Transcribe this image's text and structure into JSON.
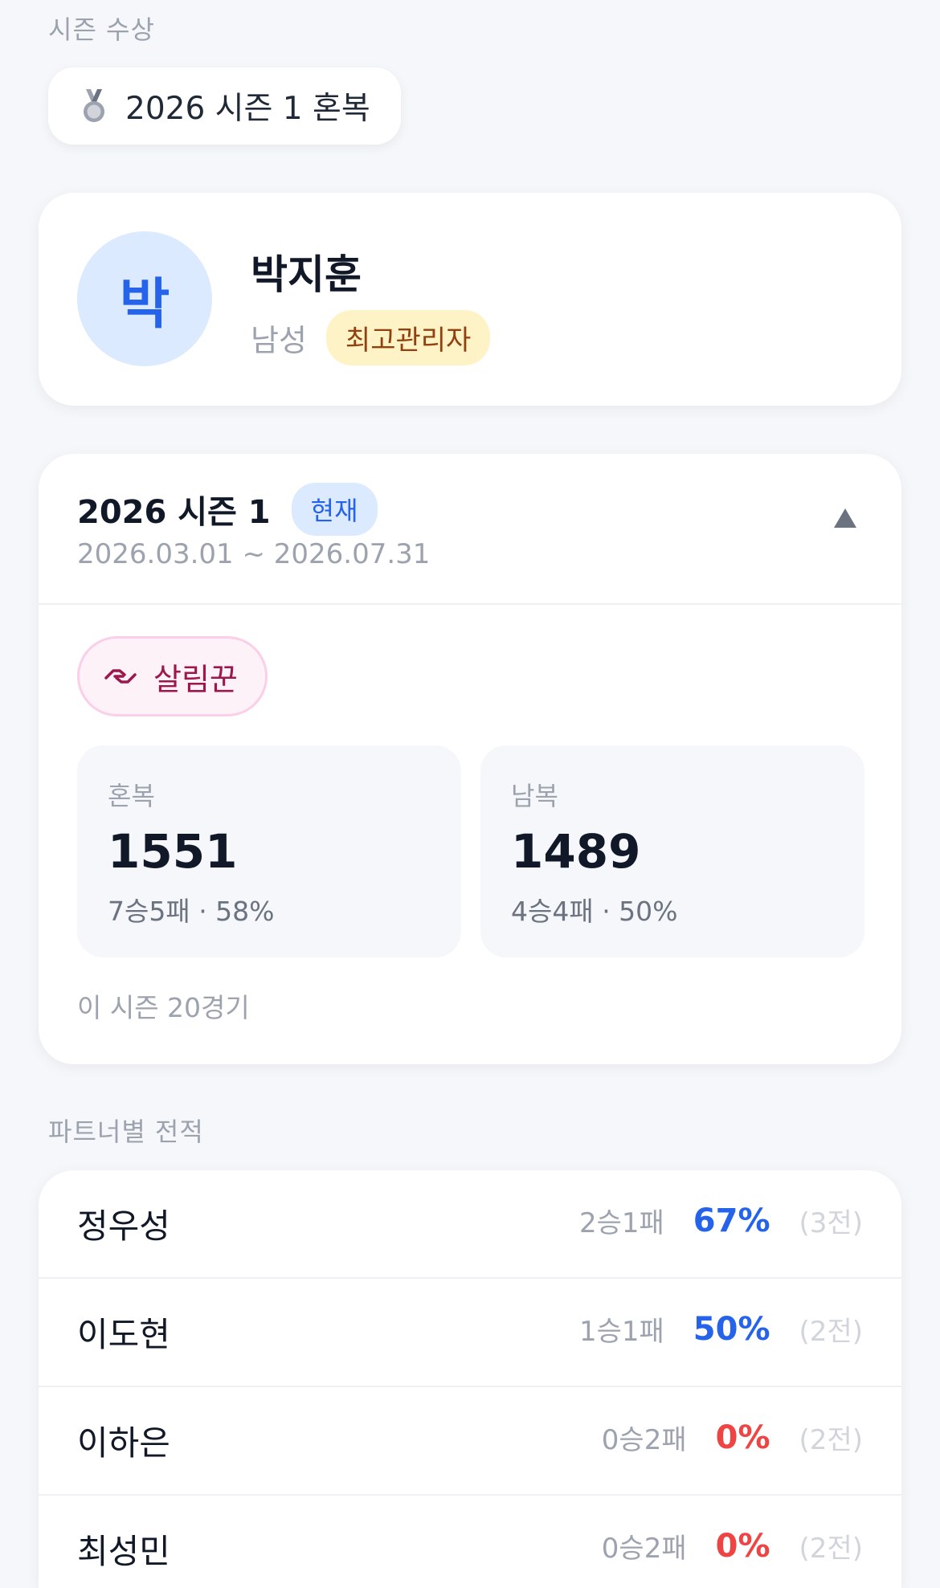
{
  "awards": {
    "section_title": "시즌 수상",
    "items": [
      {
        "icon": "medal-icon",
        "label": "2026 시즌 1 혼복"
      }
    ]
  },
  "profile": {
    "avatar_initial": "박",
    "name": "박지훈",
    "gender": "남성",
    "role_badge": "최고관리자"
  },
  "season": {
    "title": "2026 시즌 1",
    "current_badge": "현재",
    "dates": "2026.03.01 ~ 2026.07.31",
    "toggle_icon": "chevron-up-icon",
    "title_badge": {
      "icon": "handshake-icon",
      "label": "살림꾼"
    },
    "stats": [
      {
        "label": "혼복",
        "rating": "1551",
        "record": "7승5패 · 58%"
      },
      {
        "label": "남복",
        "rating": "1489",
        "record": "4승4패 · 50%"
      }
    ],
    "games_text": "이 시즌 20경기"
  },
  "partners": {
    "section_title": "파트너별 전적",
    "rows": [
      {
        "name": "정우성",
        "record": "2승1패",
        "rate": "67%",
        "games": "(3전)"
      },
      {
        "name": "이도현",
        "record": "1승1패",
        "rate": "50%",
        "games": "(2전)"
      },
      {
        "name": "이하은",
        "record": "0승2패",
        "rate": "0%",
        "games": "(2전)"
      },
      {
        "name": "최성민",
        "record": "0승2패",
        "rate": "0%",
        "games": "(2전)"
      }
    ]
  },
  "colors": {
    "accent_blue": "#2563eb",
    "negative_red": "#ef4444",
    "role_badge_bg": "#fef3c7",
    "title_badge_bg": "#fdf2f8"
  }
}
